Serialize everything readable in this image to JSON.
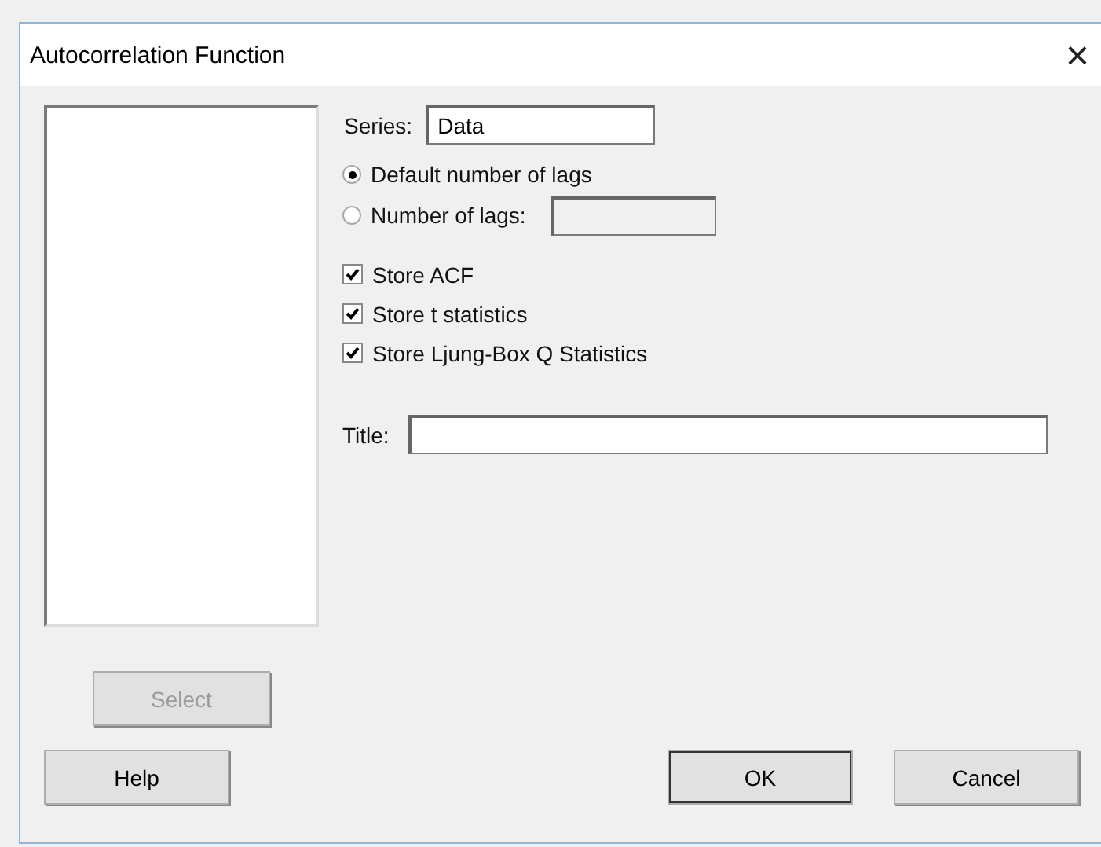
{
  "window": {
    "title": "Autocorrelation Function",
    "close": "×"
  },
  "series": {
    "label": "Series:",
    "value": "Data"
  },
  "lags": [
    {
      "label": "Default number of lags",
      "selected": true,
      "kind": "plain"
    },
    {
      "label": "Number of lags:",
      "selected": false,
      "kind": "with_field"
    }
  ],
  "options": [
    {
      "label": "Store ACF",
      "checked": true
    },
    {
      "label": "Store t statistics",
      "checked": true
    },
    {
      "label": "Store Ljung-Box Q Statistics",
      "checked": true
    }
  ],
  "title_field": {
    "label": "Title:"
  },
  "select_button": {
    "label": "Select",
    "disabled": true
  },
  "buttons": [
    {
      "label": "Help",
      "kind": "help",
      "default": false
    },
    {
      "label": "OK",
      "kind": "ok",
      "default": true
    },
    {
      "label": "Cancel",
      "kind": "cancel",
      "default": false
    }
  ]
}
